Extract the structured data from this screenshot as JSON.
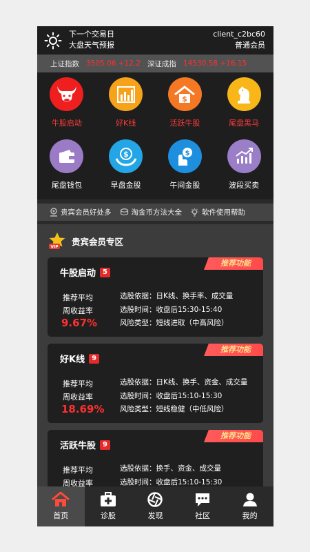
{
  "header": {
    "line1": "下一个交易日",
    "line2": "大盘天气预报",
    "client": "client_c2bc60",
    "level": "普通会员"
  },
  "ticker": {
    "sh_name": "上证指数",
    "sh_value": "3505.06 +12.2",
    "sz_name": "深证成指",
    "sz_value": "14530.58 +16.15"
  },
  "grid": [
    {
      "label": "牛股启动",
      "icon": "bull-icon",
      "color": "#ef1f1f",
      "red": true
    },
    {
      "label": "好K线",
      "icon": "bar-chart-icon",
      "color": "#f7a21b",
      "red": true
    },
    {
      "label": "活跃牛股",
      "icon": "house-coin-icon",
      "color": "#f57824",
      "red": true
    },
    {
      "label": "尾盘黑马",
      "icon": "chess-knight-icon",
      "color": "#f8b619",
      "red": true
    },
    {
      "label": "尾盘钱包",
      "icon": "wallet-icon",
      "color": "#9b7bc6",
      "red": false
    },
    {
      "label": "早盘金股",
      "icon": "hand-coin-icon",
      "color": "#24a6e6",
      "red": false
    },
    {
      "label": "午间金股",
      "icon": "touch-coin-icon",
      "color": "#1e8fde",
      "red": false
    },
    {
      "label": "波段买卖",
      "icon": "trend-chart-icon",
      "color": "#9a7ec8",
      "red": false
    }
  ],
  "helpers": [
    "贵宾会员好处多",
    "淘金币方法大全",
    "软件使用帮助"
  ],
  "vip": {
    "title": "贵宾会员专区",
    "ribbon": "推荐功能",
    "avg_line1": "推荐平均",
    "avg_line2": "周收益率",
    "cards": [
      {
        "title": "牛股启动",
        "count": "5",
        "pct": "9.67%",
        "basis": "选股依据：日K线、换手率、成交量",
        "time": "选股时间：收盘后15:30-15:40",
        "risk": "风险类型：短线进取（中高风险）"
      },
      {
        "title": "好K线",
        "count": "9",
        "pct": "18.69%",
        "basis": "选股依据：日K线、换手、资金、成交量",
        "time": "选股时间：收盘后15:10-15:30",
        "risk": "风险类型：短线稳健（中低风险）"
      },
      {
        "title": "活跃牛股",
        "count": "9",
        "pct": "",
        "basis": "选股依据：换手、资金、成交量",
        "time": "选股时间：收盘后15:10-15:30",
        "risk": ""
      }
    ]
  },
  "tabs": [
    {
      "label": "首页",
      "icon": "home-icon"
    },
    {
      "label": "诊股",
      "icon": "medical-kit-icon"
    },
    {
      "label": "发现",
      "icon": "aperture-icon"
    },
    {
      "label": "社区",
      "icon": "chat-icon"
    },
    {
      "label": "我的",
      "icon": "user-icon"
    }
  ]
}
